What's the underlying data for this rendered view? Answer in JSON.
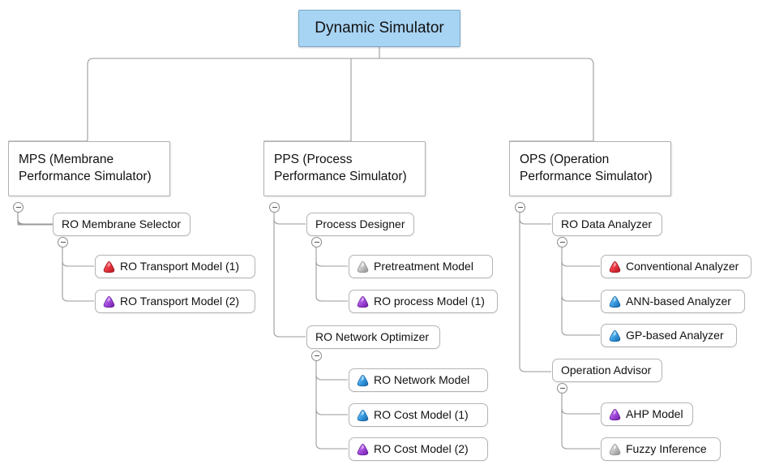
{
  "diagram": {
    "title": "Dynamic Simulator",
    "type": "hierarchy-tree",
    "background": "#ffffff",
    "root_fill": "#a8d4f4",
    "root_border": "#7aa7c7",
    "connector_color": "#9a9a9a",
    "icon_colors": {
      "red": "#e8323c",
      "purple": "#a64fe0",
      "blue": "#3fa3e8",
      "gray": "#9a9a9a"
    }
  },
  "root": {
    "label": "Dynamic Simulator"
  },
  "groups": [
    {
      "id": "mps",
      "label": "MPS (Membrane\nPerformance Simulator)"
    },
    {
      "id": "pps",
      "label": "PPS (Process\nPerformance Simulator)"
    },
    {
      "id": "ops",
      "label": "OPS (Operation\nPerformance Simulator)"
    }
  ],
  "mid_nodes": [
    {
      "id": "ro-membrane-selector",
      "label": "RO Membrane Selector"
    },
    {
      "id": "process-designer",
      "label": "Process Designer"
    },
    {
      "id": "ro-network-optimizer",
      "label": "RO Network Optimizer"
    },
    {
      "id": "ro-data-analyzer",
      "label": "RO Data Analyzer"
    },
    {
      "id": "operation-advisor",
      "label": "Operation Advisor"
    }
  ],
  "leaves": [
    {
      "id": "ro-transport-model-1",
      "label": "RO Transport Model (1)",
      "icon": "cone-icon",
      "color": "red"
    },
    {
      "id": "ro-transport-model-2",
      "label": "RO Transport Model (2)",
      "icon": "cone-icon",
      "color": "purple"
    },
    {
      "id": "pretreatment-model",
      "label": "Pretreatment Model",
      "icon": "cone-icon",
      "color": "gray"
    },
    {
      "id": "ro-process-model-1",
      "label": "RO process Model (1)",
      "icon": "cone-icon",
      "color": "purple"
    },
    {
      "id": "ro-network-model",
      "label": "RO Network Model",
      "icon": "cone-icon",
      "color": "blue"
    },
    {
      "id": "ro-cost-model-1",
      "label": "RO Cost Model (1)",
      "icon": "cone-icon",
      "color": "blue"
    },
    {
      "id": "ro-cost-model-2",
      "label": "RO Cost Model (2)",
      "icon": "cone-icon",
      "color": "purple"
    },
    {
      "id": "conventional-analyzer",
      "label": "Conventional Analyzer",
      "icon": "cone-icon",
      "color": "red"
    },
    {
      "id": "ann-based-analyzer",
      "label": "ANN-based Analyzer",
      "icon": "cone-icon",
      "color": "blue"
    },
    {
      "id": "gp-based-analyzer",
      "label": "GP-based Analyzer",
      "icon": "cone-icon",
      "color": "blue"
    },
    {
      "id": "ahp-model",
      "label": "AHP Model",
      "icon": "cone-icon",
      "color": "purple"
    },
    {
      "id": "fuzzy-inference",
      "label": "Fuzzy Inference",
      "icon": "cone-icon",
      "color": "gray"
    }
  ],
  "toggles": [
    {
      "id": "toggle-mps",
      "state": "expanded"
    },
    {
      "id": "toggle-ro-membrane-selector",
      "state": "expanded"
    },
    {
      "id": "toggle-pps",
      "state": "expanded"
    },
    {
      "id": "toggle-process-designer",
      "state": "expanded"
    },
    {
      "id": "toggle-ro-network-optimizer",
      "state": "expanded"
    },
    {
      "id": "toggle-ops",
      "state": "expanded"
    },
    {
      "id": "toggle-ro-data-analyzer",
      "state": "expanded"
    },
    {
      "id": "toggle-operation-advisor",
      "state": "expanded"
    }
  ]
}
